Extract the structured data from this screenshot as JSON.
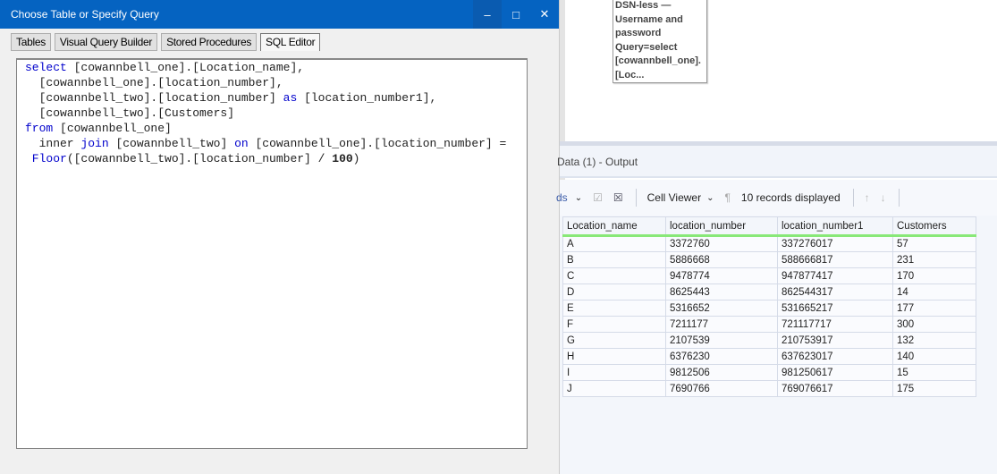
{
  "dialog": {
    "title": "Choose Table or Specify Query",
    "tabs": [
      "Tables",
      "Visual Query Builder",
      "Stored Procedures",
      "SQL Editor"
    ],
    "active_tab": "SQL Editor",
    "sql": [
      [
        [
          "kw",
          "select"
        ],
        [
          "t",
          " [cowannbell_one].[Location_name],"
        ]
      ],
      [
        [
          "t",
          "  [cowannbell_one].[location_number],"
        ]
      ],
      [
        [
          "t",
          "  [cowannbell_two].[location_number] "
        ],
        [
          "kw",
          "as"
        ],
        [
          "t",
          " [location_number1],"
        ]
      ],
      [
        [
          "t",
          "  [cowannbell_two].[Customers]"
        ]
      ],
      [
        [
          "kw",
          "from"
        ],
        [
          "t",
          " [cowannbell_one]"
        ]
      ],
      [
        [
          "t",
          "  inner "
        ],
        [
          "kw",
          "join"
        ],
        [
          "t",
          " [cowannbell_two] "
        ],
        [
          "kw",
          "on"
        ],
        [
          "t",
          " [cowannbell_one].[location_number] ="
        ]
      ],
      [
        [
          "kw",
          " Floor"
        ],
        [
          "t",
          "([cowannbell_two].[location_number] / "
        ],
        [
          "num",
          "100"
        ],
        [
          "t",
          ")"
        ]
      ]
    ]
  },
  "tooltip": [
    "DSN-less —",
    "Username and",
    "password",
    "Query=select",
    "[cowannbell_one].",
    "[Loc..."
  ],
  "output": {
    "title": "Data (1) - Output",
    "toolbar": {
      "fields_label": "ds",
      "cell_viewer": "Cell Viewer",
      "records": "10 records displayed"
    },
    "columns": [
      "Location_name",
      "location_number",
      "location_number1",
      "Customers"
    ],
    "rows": [
      [
        "A",
        "3372760",
        "337276017",
        "57"
      ],
      [
        "B",
        "5886668",
        "588666817",
        "231"
      ],
      [
        "C",
        "9478774",
        "947877417",
        "170"
      ],
      [
        "D",
        "8625443",
        "862544317",
        "14"
      ],
      [
        "E",
        "5316652",
        "531665217",
        "177"
      ],
      [
        "F",
        "7211177",
        "721117717",
        "300"
      ],
      [
        "G",
        "2107539",
        "210753917",
        "132"
      ],
      [
        "H",
        "6376230",
        "637623017",
        "140"
      ],
      [
        "I",
        "9812506",
        "981250617",
        "15"
      ],
      [
        "J",
        "7690766",
        "769076617",
        "175"
      ]
    ]
  }
}
